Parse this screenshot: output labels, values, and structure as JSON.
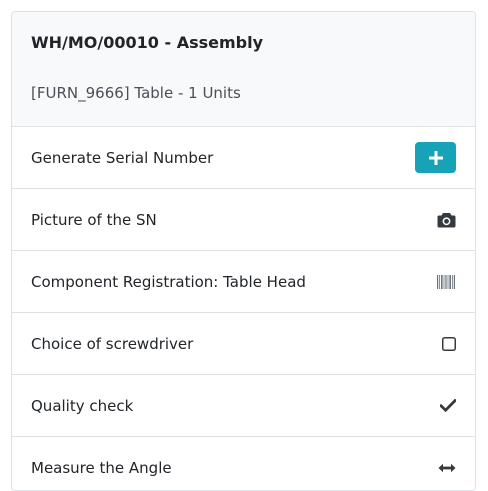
{
  "header": {
    "title": "WH/MO/00010 - Assembly",
    "subtitle": "[FURN_9666] Table - 1 Units"
  },
  "steps": [
    {
      "label": "Generate Serial Number",
      "icon": "plus-icon"
    },
    {
      "label": "Picture of the SN",
      "icon": "camera-icon"
    },
    {
      "label": "Component Registration: Table Head",
      "icon": "barcode-icon"
    },
    {
      "label": "Choice of screwdriver",
      "icon": "checkbox-icon"
    },
    {
      "label": "Quality check",
      "icon": "check-icon"
    },
    {
      "label": "Measure the Angle",
      "icon": "arrows-horizontal-icon"
    }
  ],
  "colors": {
    "accent": "#17a2b8",
    "header_bg": "#f8f9fa",
    "border": "#dee2e6",
    "icon": "#343a40"
  }
}
